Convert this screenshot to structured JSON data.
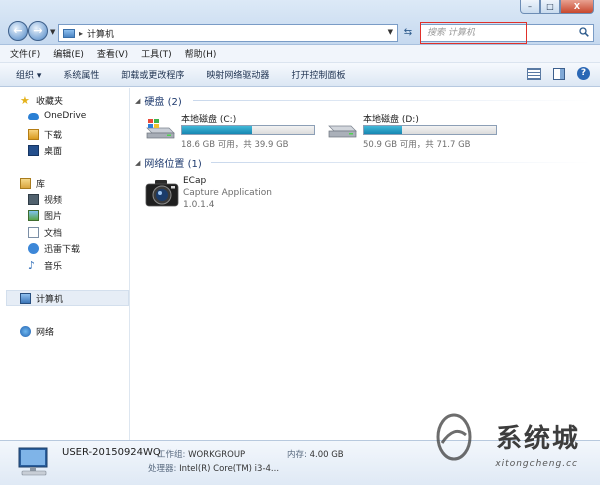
{
  "window": {
    "minimize": "–",
    "maximize": "□",
    "close": "X"
  },
  "address": {
    "crumb": "计算机",
    "sep": "▸"
  },
  "search": {
    "placeholder": "搜索 计算机"
  },
  "menu": [
    "文件(F)",
    "编辑(E)",
    "查看(V)",
    "工具(T)",
    "帮助(H)"
  ],
  "toolbar": {
    "organize": "组织 ▾",
    "system_properties": "系统属性",
    "uninstall": "卸载或更改程序",
    "map_drive": "映射网络驱动器",
    "control_panel": "打开控制面板"
  },
  "sidebar": {
    "favorites": "收藏夹",
    "onedrive": "OneDrive",
    "downloads": "下载",
    "desktop": "桌面",
    "libraries": "库",
    "videos": "视频",
    "pictures": "图片",
    "documents": "文档",
    "thunder": "迅雷下载",
    "music": "音乐",
    "computer": "计算机",
    "network": "网络"
  },
  "groups": {
    "hard_drives": "硬盘 (2)",
    "network_locations": "网络位置 (1)"
  },
  "drives": [
    {
      "name": "本地磁盘 (C:)",
      "free": "18.6 GB 可用，共 39.9 GB",
      "used_fraction": 0.53
    },
    {
      "name": "本地磁盘 (D:)",
      "free": "50.9 GB 可用，共 71.7 GB",
      "used_fraction": 0.29
    }
  ],
  "network_item": {
    "name": "ECap",
    "description": "Capture Application",
    "version": "1.0.1.4"
  },
  "details": {
    "computer_name": "USER-20150924WQ",
    "workgroup_label": "工作组:",
    "workgroup": "WORKGROUP",
    "memory_label": "内存:",
    "memory": "4.00 GB",
    "cpu_label": "处理器:",
    "cpu": "Intel(R) Core(TM) i3-4..."
  },
  "watermark": {
    "text": "系统城",
    "sub": "xitongcheng.cc"
  },
  "colors": {
    "accent": "#2a67b5",
    "drive_fill": "#1586b2",
    "highlight": "#e0302a"
  }
}
